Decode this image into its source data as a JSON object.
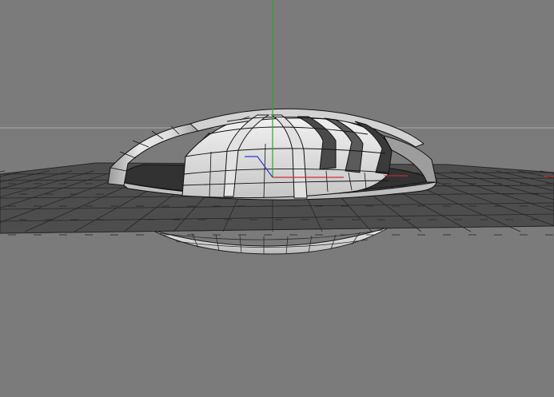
{
  "viewport": {
    "background": "#7b7b7b",
    "axis_colors": {
      "x_axis": "#d03030",
      "y_axis": "#2fa52f",
      "z_axis": "#2d3bd0",
      "horizon": "#a8a8a8"
    },
    "mesh_colors": {
      "ground_plane": "#4d4d4d",
      "ground_wire": "#262626",
      "dome_light": "#ebebeb",
      "dome_mid": "#c9c9c9",
      "dome_shadow": "#8e8e8e",
      "interior": "#323232",
      "edges": "#111111"
    },
    "icons": {
      "world_axis": "axis-gizmo-icon"
    }
  }
}
